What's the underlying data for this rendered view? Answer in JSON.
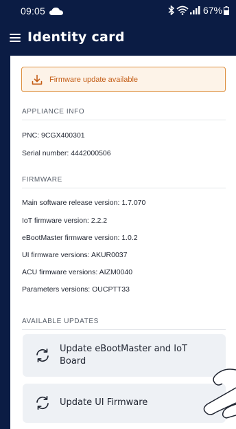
{
  "status": {
    "time": "09:05",
    "battery": "67%"
  },
  "appbar": {
    "title": "Identity card"
  },
  "banner": {
    "label": "Firmware update available"
  },
  "appliance_info": {
    "section_title": "APPLIANCE INFO",
    "pnc": "PNC: 9CGX400301",
    "serial": "Serial number: 4442000506"
  },
  "firmware": {
    "section_title": "FIRMWARE",
    "lines": [
      "Main software release version: 1.7.070",
      "IoT firmware version: 2.2.2",
      "eBootMaster firmware version: 1.0.2",
      "UI firmware versions: AKUR0037",
      "ACU firmware versions: AIZM0040",
      "Parameters versions: OUCPTT33"
    ]
  },
  "updates": {
    "section_title": "AVAILABLE UPDATES",
    "items": [
      {
        "label_line1": "Update eBootMaster and IoT",
        "label_line2": "Board"
      },
      {
        "label_line1": "Update UI Firmware"
      }
    ]
  },
  "colors": {
    "header_bg": "#0b1c44",
    "banner_accent": "#dd8f3e",
    "banner_text": "#c45d16",
    "card_bg": "#eef1f5"
  }
}
